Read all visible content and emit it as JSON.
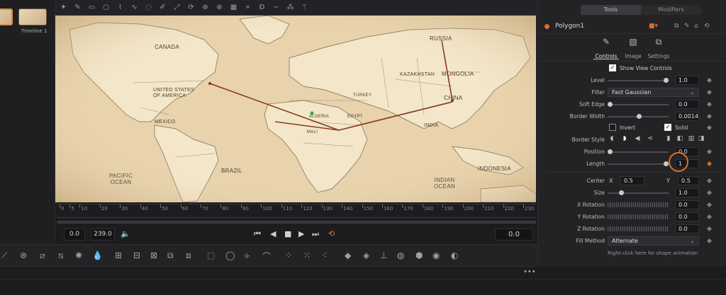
{
  "media_pool": {
    "timeline_label": "Timeline 1"
  },
  "viewer": {
    "map_labels": [
      "CANADA",
      "UNITED STATES\nOF AMERICA",
      "MEXICO",
      "BRAZIL",
      "PACIFIC\nOCEAN",
      "RUSSIA",
      "MONGOLIA",
      "CHINA",
      "KAZAKHSTAN",
      "INDIA",
      "INDONESIA",
      "INDIAN\nOCEAN",
      "ALGERIA",
      "EGYPT",
      "TURKEY",
      "MALI"
    ]
  },
  "ruler": {
    "ticks": [
      "0",
      "5",
      "10",
      "20",
      "30",
      "40",
      "50",
      "60",
      "70",
      "80",
      "90",
      "100",
      "110",
      "120",
      "130",
      "140",
      "150",
      "160",
      "170",
      "180",
      "190",
      "200",
      "210",
      "220",
      "230"
    ]
  },
  "transport": {
    "start": "0.0",
    "end": "239.0",
    "current": "0.0"
  },
  "inspector": {
    "tabs": [
      "Tools",
      "Modifiers"
    ],
    "node_name": "Polygon1",
    "subtabs": [
      "Controls",
      "Image",
      "Settings"
    ],
    "show_view_controls": "Show View Controls",
    "level": {
      "label": "Level",
      "value": "1.0"
    },
    "filter": {
      "label": "Filter",
      "value": "Fast Gaussian"
    },
    "soft_edge": {
      "label": "Soft Edge",
      "value": "0.0"
    },
    "border_width": {
      "label": "Border Width",
      "value": "0.0014"
    },
    "invert": "Invert",
    "solid": "Solid",
    "border_style": {
      "label": "Border Style"
    },
    "position": {
      "label": "Position",
      "value": "0.0"
    },
    "length": {
      "label": "Length",
      "value": "1"
    },
    "center": {
      "label": "Center",
      "x_label": "X",
      "x": "0.5",
      "y_label": "Y",
      "y": "0.5"
    },
    "size": {
      "label": "Size",
      "value": "1.0"
    },
    "x_rotation": {
      "label": "X Rotation",
      "value": "0.0"
    },
    "y_rotation": {
      "label": "Y Rotation",
      "value": "0.0"
    },
    "z_rotation": {
      "label": "Z Rotation",
      "value": "0.0"
    },
    "fill_method": {
      "label": "Fill Method",
      "value": "Alternate"
    },
    "hint": "Right-click here for shape animation"
  },
  "colors": {
    "accent": "#e06b2b",
    "map_bg": "#e8d3ad",
    "route_line": "#8a3b1c"
  }
}
